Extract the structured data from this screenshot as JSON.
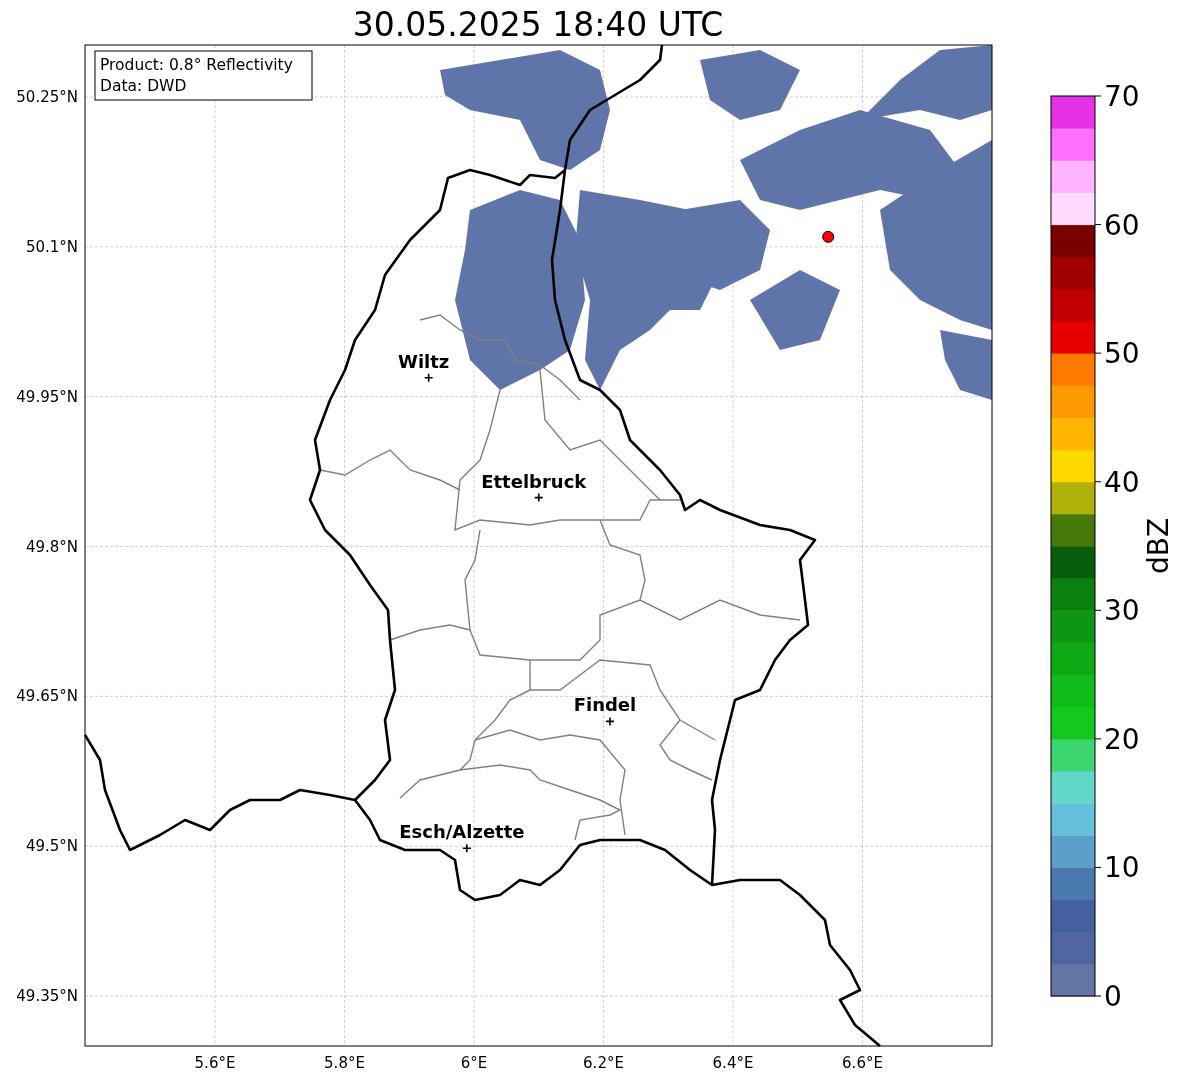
{
  "title": "30.05.2025 18:40 UTC",
  "info_box": [
    "Product: 0.8° Reflectivity",
    "Data: DWD"
  ],
  "lon_ticks": [
    "5.6°E",
    "5.8°E",
    "6°E",
    "6.2°E",
    "6.4°E",
    "6.6°E"
  ],
  "lat_ticks": [
    "50.25°N",
    "50.1°N",
    "49.95°N",
    "49.8°N",
    "49.65°N",
    "49.5°N",
    "49.35°N"
  ],
  "cities": [
    "Wiltz",
    "Ettelbruck",
    "Findel",
    "Esch/Alzette"
  ],
  "colorbar": {
    "label": "dBZ",
    "ticks": [
      "70",
      "60",
      "50",
      "40",
      "30",
      "20",
      "10",
      "0"
    ]
  }
}
